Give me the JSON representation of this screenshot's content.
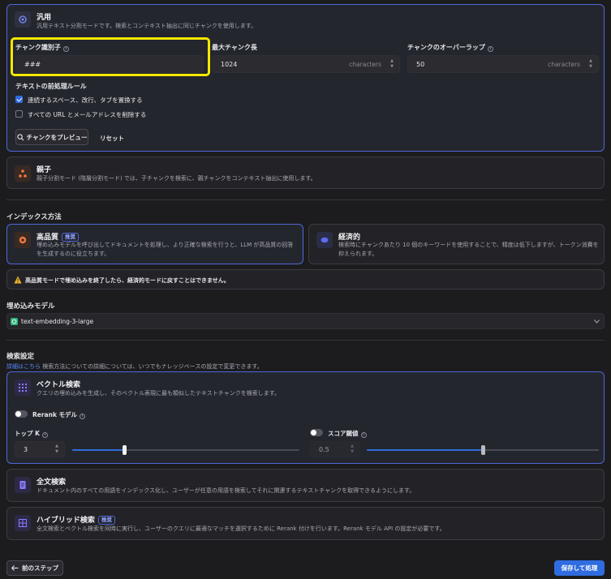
{
  "general": {
    "title": "汎用",
    "desc": "汎用テキスト分割モードです。検索とコンテキスト抽出に同じチャンクを使用します。",
    "chunk_id_label": "チャンク識別子",
    "chunk_id_value": "###",
    "max_chunk_label": "最大チャンク長",
    "max_chunk_value": "1024",
    "max_chunk_unit": "characters",
    "overlap_label": "チャンクのオーバーラップ",
    "overlap_value": "50",
    "overlap_unit": "characters",
    "preprocess_label": "テキストの前処理ルール",
    "rule1": "連続するスペース、改行、タブを置換する",
    "rule1_checked": true,
    "rule2": "すべての URL とメールアドレスを削除する",
    "rule2_checked": false,
    "preview_button": "チャンクをプレビュー",
    "reset_button": "リセット"
  },
  "parent_child": {
    "title": "親子",
    "desc": "親子分割モード (階層分割モード) では、子チャンクを検索に、親チャンクをコンテキスト抽出に使用します。"
  },
  "index": {
    "section_label": "インデックス方法",
    "high_title": "高品質",
    "high_badge": "推奨",
    "high_desc": "埋め込みモデルを呼び出してドキュメントを処理し、より正確な検索を行うと、LLM が高品質の回答を生成するのに役立ちます。",
    "eco_title": "経済的",
    "eco_desc": "検索時にチャンクあたり 10 個のキーワードを使用することで、精度は低下しますが、トークン消費を抑えられます。",
    "warning": "高品質モードで埋め込みを終了したら、経済的モードに戻すことはできません。"
  },
  "embedding": {
    "section_label": "埋め込みモデル",
    "model": "text-embedding-3-large"
  },
  "search": {
    "section_label": "検索設定",
    "link": "詳細はこちら",
    "note": " 検索方法についての詳細については、いつでもナレッジベースの設定で変更できます。",
    "vector_title": "ベクトル検索",
    "vector_desc": "クエリの埋め込みを生成し、そのベクトル表現に最も類似したテキストチャンクを検索します。",
    "rerank_label": "Rerank モデル",
    "topk_label": "トップ K",
    "topk_value": "3",
    "topk_fraction": 0.23,
    "score_label": "スコア閾値",
    "score_value": "0.5",
    "score_fraction": 0.5,
    "fulltext_title": "全文検索",
    "fulltext_desc": "ドキュメント内のすべての用語をインデックス化し、ユーザーが任意の用語を検索してそれに関連するテキストチャンクを取得できるようにします。",
    "hybrid_title": "ハイブリッド検索",
    "hybrid_badge": "推奨",
    "hybrid_desc": "全文検索とベクトル検索を同時に実行し、ユーザーのクエリに最適なマッチを選択するために Rerank 付けを行います。Rerank モデル API の設定が必要です。"
  },
  "footer": {
    "back_button": "前のステップ",
    "save_button": "保存して処理"
  },
  "colors": {
    "accent": "#2f6ce0",
    "highlight": "#f5e800",
    "selected_border": "#4f67d8"
  }
}
